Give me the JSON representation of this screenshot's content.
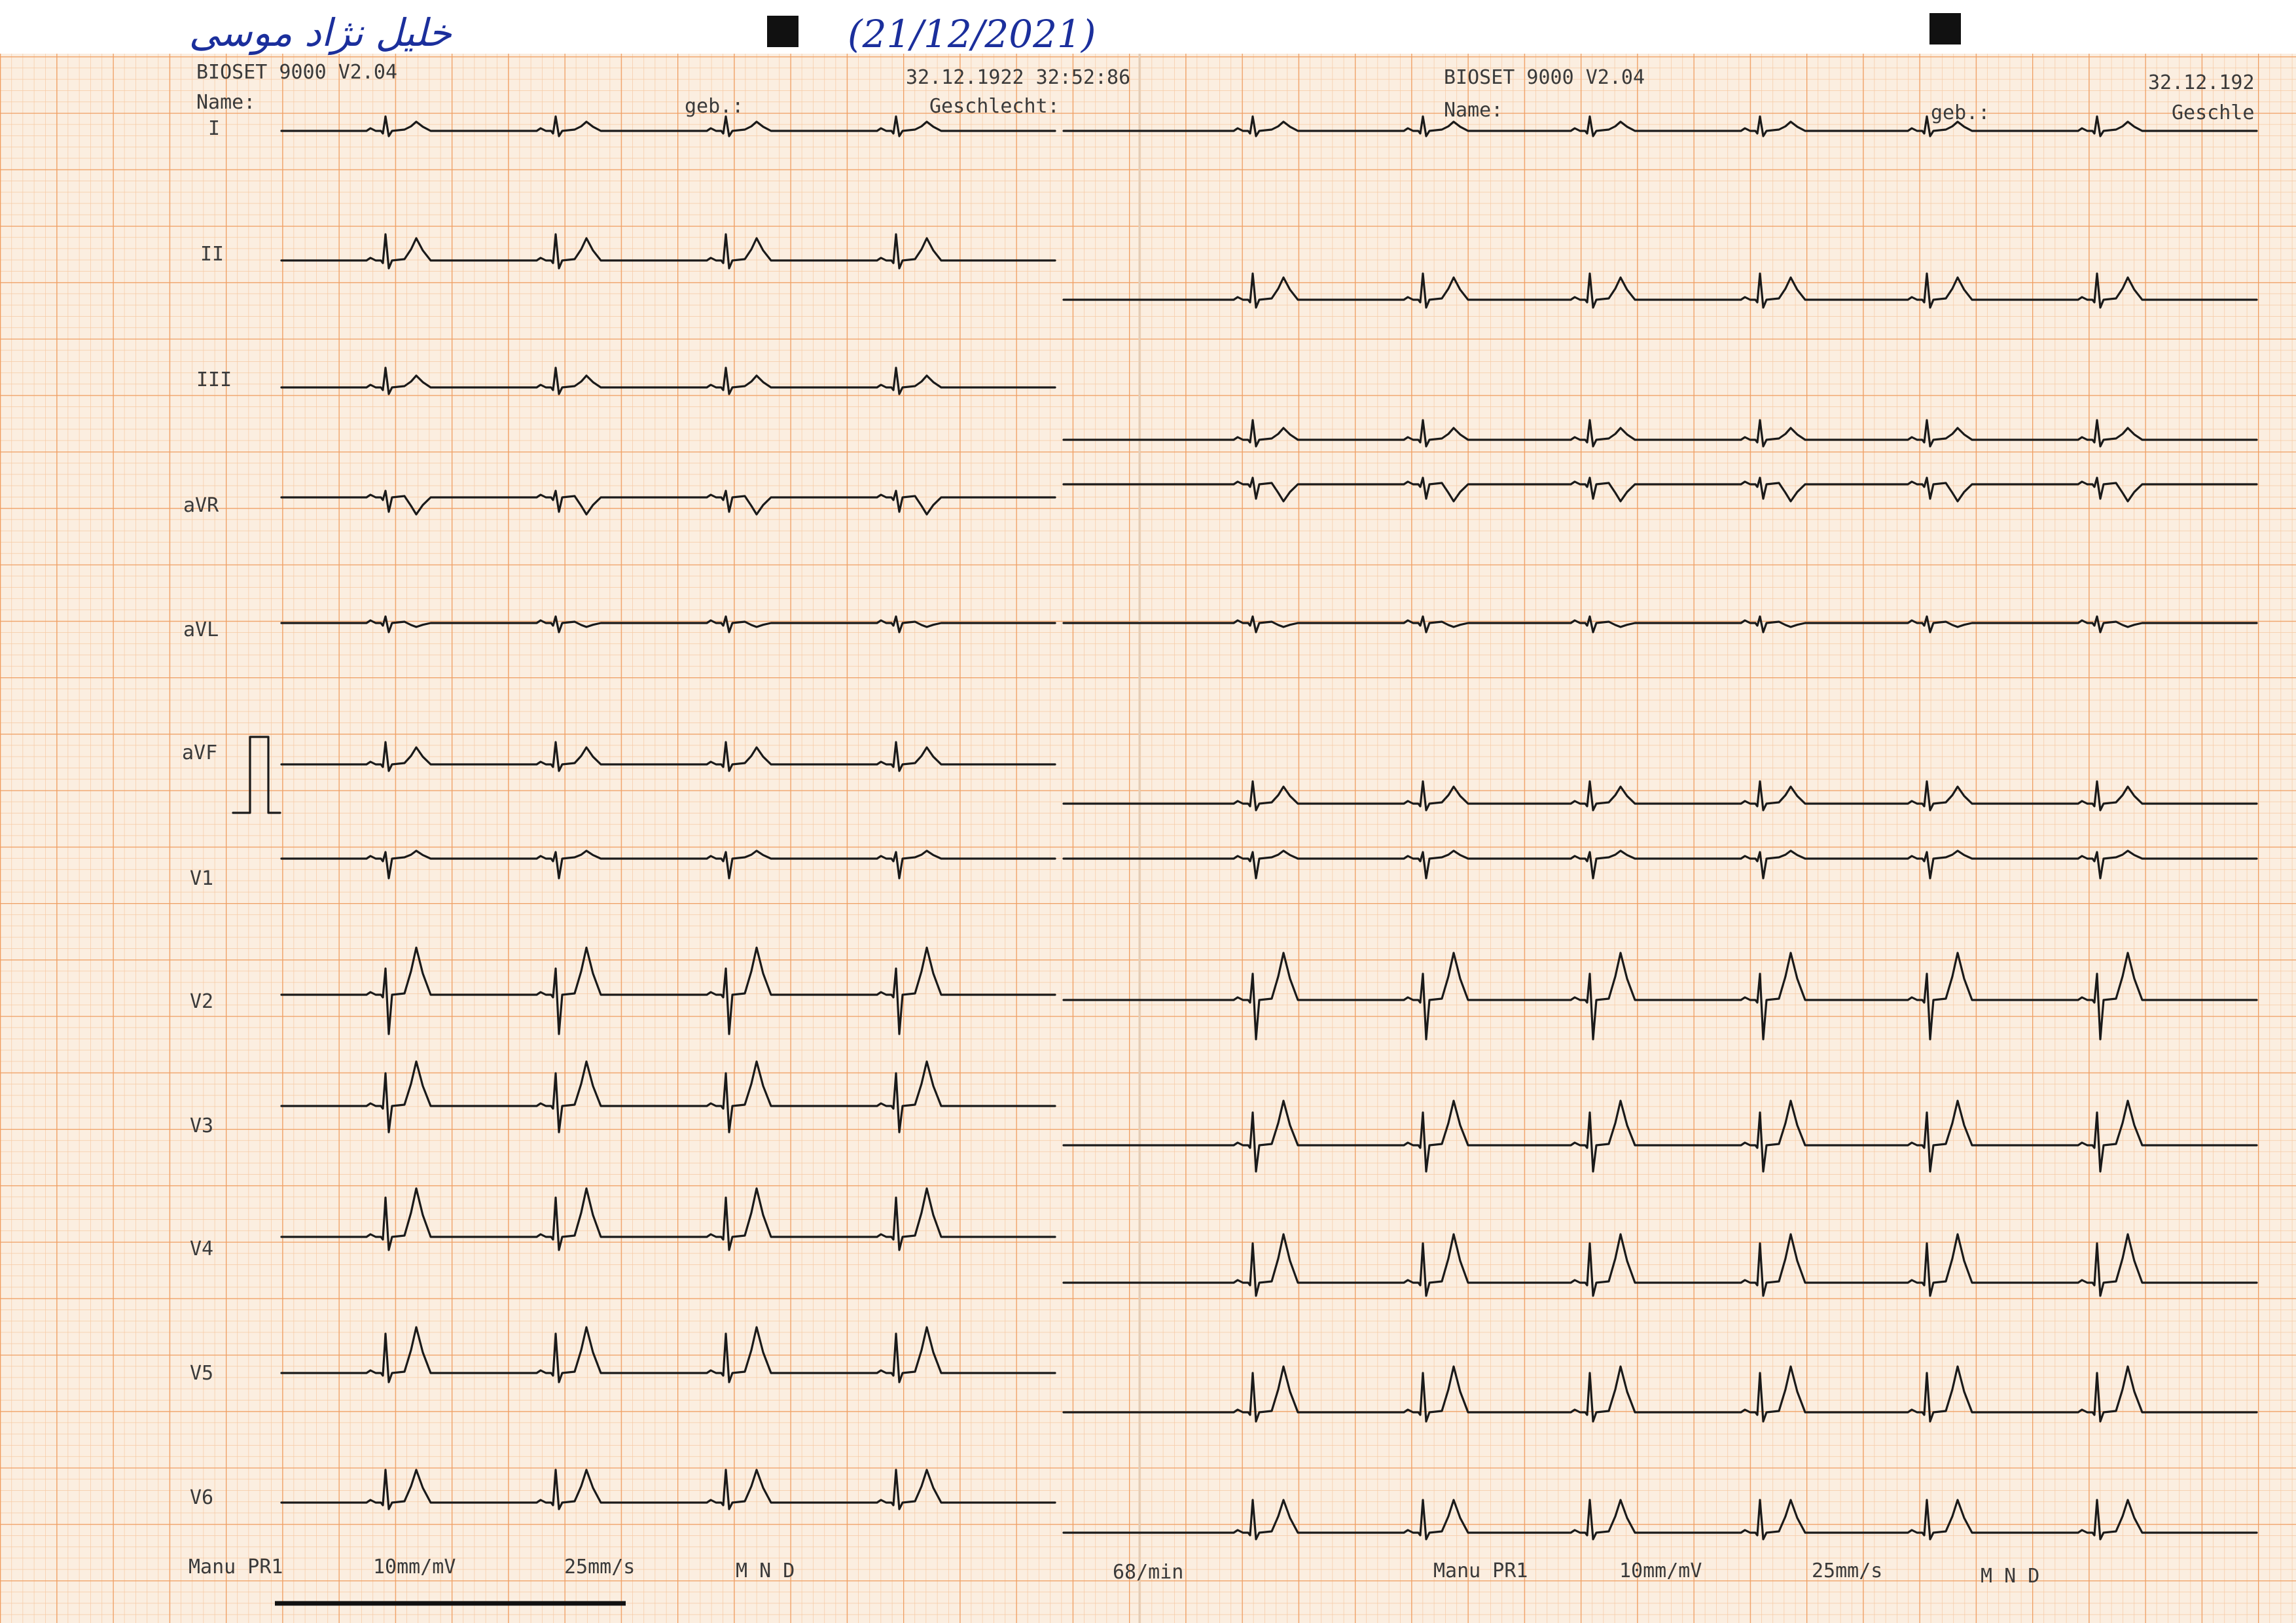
{
  "handwriting": {
    "patient_name": "خلیل نژاد موسی",
    "date": "(21/12/2021)"
  },
  "left_page": {
    "device": "BIOSET 9000 V2.04",
    "name_label": "Name:",
    "birth_label": "geb.:",
    "date_time": "32.12.1922 32:52:86",
    "sex_label": "Geschlecht:"
  },
  "right_page": {
    "device": "BIOSET 9000 V2.04",
    "name_label": "Name:",
    "birth_label": "geb.:",
    "date": "32.12.192",
    "sex_label": "Geschle"
  },
  "leads": [
    "I",
    "II",
    "III",
    "aVR",
    "aVL",
    "aVF",
    "V1",
    "V2",
    "V3",
    "V4",
    "V5",
    "V6"
  ],
  "footer_left": {
    "mode": "Manu PR1",
    "gain": "10mm/mV",
    "speed": "25mm/s",
    "filters": "M  N  D"
  },
  "footer_mid": {
    "heart_rate": "68/min"
  },
  "footer_right": {
    "mode": "Manu PR1",
    "gain": "10mm/mV",
    "speed": "25mm/s",
    "filters": "M  N  D"
  },
  "colors": {
    "paper": "#fbeee0",
    "grid_minor": "#f6c9a3",
    "grid_major": "#ef9e62",
    "trace": "#1a1a1a",
    "ink": "#1b2f9c"
  }
}
